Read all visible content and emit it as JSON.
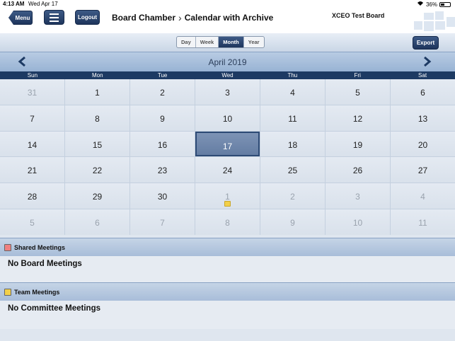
{
  "status": {
    "time": "4:13 AM",
    "date": "Wed Apr 17",
    "battery": "36%"
  },
  "header": {
    "menu_label": "Menu",
    "logout_label": "Logout",
    "breadcrumb_parent": "Board Chamber",
    "breadcrumb_current": "Calendar with Archive",
    "board_name": "XCEO Test Board"
  },
  "toolbar": {
    "views": [
      "Day",
      "Week",
      "Month",
      "Year"
    ],
    "active_view": "Month",
    "export_label": "Export"
  },
  "calendar": {
    "month_title": "April 2019",
    "weekdays": [
      "Sun",
      "Mon",
      "Tue",
      "Wed",
      "Thu",
      "Fri",
      "Sat"
    ],
    "today": "17",
    "days": [
      {
        "d": "31",
        "other": true
      },
      {
        "d": "1"
      },
      {
        "d": "2"
      },
      {
        "d": "3"
      },
      {
        "d": "4"
      },
      {
        "d": "5"
      },
      {
        "d": "6"
      },
      {
        "d": "7"
      },
      {
        "d": "8"
      },
      {
        "d": "9"
      },
      {
        "d": "10"
      },
      {
        "d": "11"
      },
      {
        "d": "12"
      },
      {
        "d": "13"
      },
      {
        "d": "14"
      },
      {
        "d": "15"
      },
      {
        "d": "16"
      },
      {
        "d": "17",
        "today": true
      },
      {
        "d": "18"
      },
      {
        "d": "19"
      },
      {
        "d": "20"
      },
      {
        "d": "21"
      },
      {
        "d": "22"
      },
      {
        "d": "23"
      },
      {
        "d": "24"
      },
      {
        "d": "25"
      },
      {
        "d": "26"
      },
      {
        "d": "27"
      },
      {
        "d": "28"
      },
      {
        "d": "29"
      },
      {
        "d": "30"
      },
      {
        "d": "1",
        "other": true,
        "event": "team"
      },
      {
        "d": "2",
        "other": true
      },
      {
        "d": "3",
        "other": true
      },
      {
        "d": "4",
        "other": true
      },
      {
        "d": "5",
        "other": true
      },
      {
        "d": "6",
        "other": true
      },
      {
        "d": "7",
        "other": true
      },
      {
        "d": "8",
        "other": true
      },
      {
        "d": "9",
        "other": true
      },
      {
        "d": "10",
        "other": true
      },
      {
        "d": "11",
        "other": true
      }
    ]
  },
  "shared": {
    "label": "Shared Meetings",
    "color": "#f08080",
    "empty_text": "No Board Meetings"
  },
  "team": {
    "label": "Team Meetings",
    "color": "#f2d04a",
    "empty_text": "No Committee Meetings"
  },
  "colors": {
    "nav_dark": "#1d3a63",
    "accent": "#2d4a75"
  }
}
